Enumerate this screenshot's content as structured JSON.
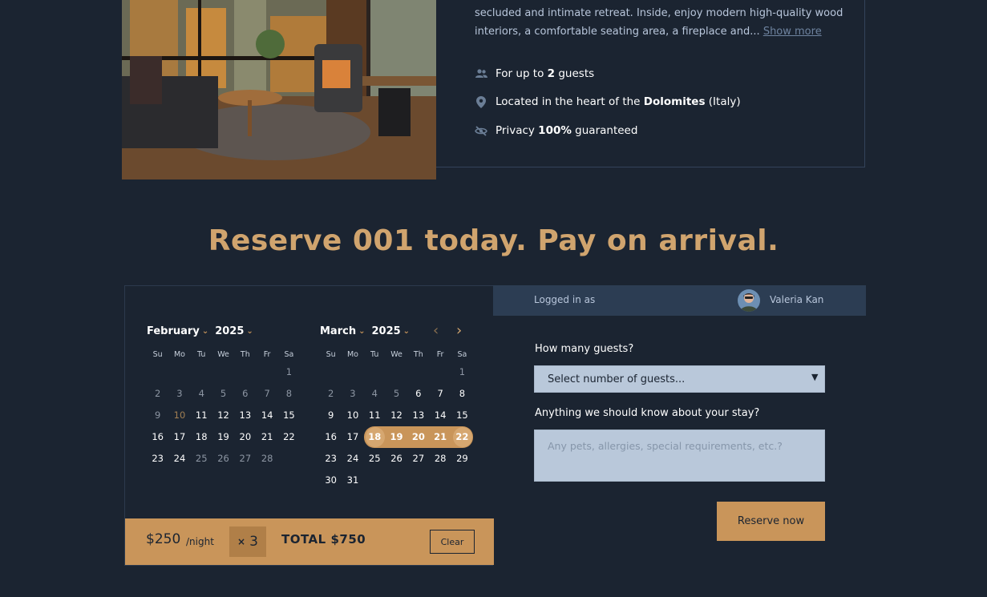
{
  "listing": {
    "description_text": "secluded and intimate retreat. Inside, enjoy modern high-quality wood interiors, a comfortable seating area, a fireplace and...",
    "show_more_label": "Show more",
    "features": [
      {
        "icon": "guests-icon",
        "prefix": "For up to ",
        "bold": "2",
        "suffix": " guests"
      },
      {
        "icon": "location-pin-icon",
        "prefix": "Located in the heart of the ",
        "bold": "Dolomites",
        "suffix": " (Italy)"
      },
      {
        "icon": "eye-off-icon",
        "prefix": "Privacy ",
        "bold": "100%",
        "suffix": " guaranteed"
      }
    ]
  },
  "headline": "Reserve 001 today. Pay on arrival.",
  "calendar": {
    "weekdays": [
      "Su",
      "Mo",
      "Tu",
      "We",
      "Th",
      "Fr",
      "Sa"
    ],
    "months": [
      {
        "month": "February",
        "year": "2025",
        "leading_blanks": 6,
        "days": 28,
        "past_days": [
          1,
          2,
          3,
          4,
          5,
          6,
          7,
          8,
          9,
          25,
          26,
          27,
          28
        ],
        "today": 10,
        "selected_days": []
      },
      {
        "month": "March",
        "year": "2025",
        "leading_blanks": 6,
        "days": 31,
        "past_days": [
          1,
          2,
          3,
          4,
          5
        ],
        "today": null,
        "selected_days": [
          18,
          19,
          20,
          21,
          22
        ]
      }
    ],
    "nav_prev": "‹",
    "nav_next": "›"
  },
  "pricing": {
    "price": "$250",
    "per_night": "/night",
    "multiplier_symbol": "×",
    "nights": "3",
    "total": "TOTAL $750",
    "clear_label": "Clear"
  },
  "account": {
    "logged_in_label": "Logged in as",
    "user_name": "Valeria Kan"
  },
  "form": {
    "guests_label": "How many guests?",
    "guests_selected": "Select number of guests...",
    "notes_label": "Anything we should know about your stay?",
    "notes_placeholder": "Any pets, allergies, special requirements, etc.?",
    "reserve_label": "Reserve now"
  },
  "colors": {
    "background": "#1b2431",
    "accent": "#c9955a",
    "heading": "#d0a46e",
    "input_bg": "#b9c8da"
  }
}
